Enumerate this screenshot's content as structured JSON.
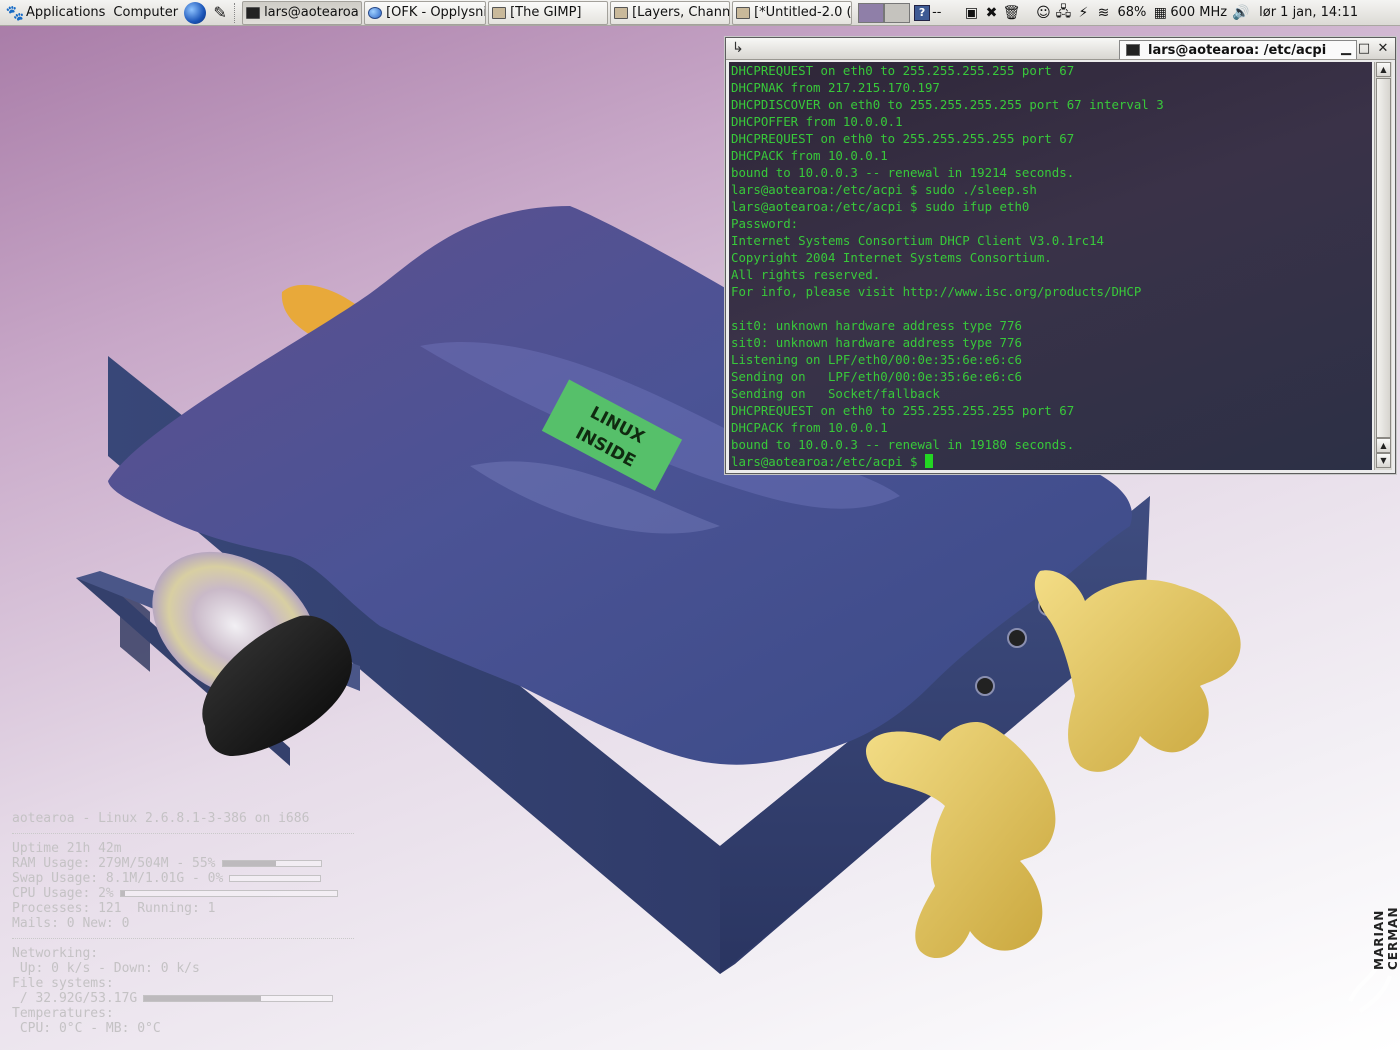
{
  "panel": {
    "applications_label": "Applications",
    "computer_label": "Computer",
    "tasks": [
      {
        "label": "lars@aotearoa",
        "icon": "terminal-icon"
      },
      {
        "label": "[OFK - Opplysni",
        "icon": "web-browser-icon"
      },
      {
        "label": "[The GIMP]",
        "icon": "gimp-icon"
      },
      {
        "label": "[Layers, Chann",
        "icon": "gimp-icon"
      },
      {
        "label": "[*Untitled-2.0 (",
        "icon": "gimp-icon"
      }
    ],
    "help_glyph": "?",
    "help_suffix": "--",
    "battery_label": "68%",
    "cpu_freq_label": "600 MHz",
    "clock_label": "lør  1 jan, 14:11"
  },
  "terminal": {
    "tab_title": "lars@aotearoa: /etc/acpi",
    "menu_glyph": "↳",
    "lines": [
      "DHCPREQUEST on eth0 to 255.255.255.255 port 67",
      "DHCPNAK from 217.215.170.197",
      "DHCPDISCOVER on eth0 to 255.255.255.255 port 67 interval 3",
      "DHCPOFFER from 10.0.0.1",
      "DHCPREQUEST on eth0 to 255.255.255.255 port 67",
      "DHCPACK from 10.0.0.1",
      "bound to 10.0.0.3 -- renewal in 19214 seconds.",
      "lars@aotearoa:/etc/acpi $ sudo ./sleep.sh",
      "lars@aotearoa:/etc/acpi $ sudo ifup eth0",
      "Password:",
      "Internet Systems Consortium DHCP Client V3.0.1rc14",
      "Copyright 2004 Internet Systems Consortium.",
      "All rights reserved.",
      "For info, please visit http://www.isc.org/products/DHCP",
      "",
      "sit0: unknown hardware address type 776",
      "sit0: unknown hardware address type 776",
      "Listening on LPF/eth0/00:0e:35:6e:e6:c6",
      "Sending on   LPF/eth0/00:0e:35:6e:e6:c6",
      "Sending on   Socket/fallback",
      "DHCPREQUEST on eth0 to 255.255.255.255 port 67",
      "DHCPACK from 10.0.0.1",
      "bound to 10.0.0.3 -- renewal in 19180 seconds."
    ],
    "prompt": "lars@aotearoa:/etc/acpi $ "
  },
  "wallpaper": {
    "badge_line1": "LINUX",
    "badge_line2": "INSIDE",
    "signature": "MARIAN CERMAN"
  },
  "sysmon": {
    "header": "aotearoa - Linux 2.6.8.1-3-386 on i686",
    "uptime": "Uptime 21h 42m",
    "ram_label": "RAM Usage: 279M/504M - 55%",
    "ram_fraction": 0.55,
    "swap_label": "Swap Usage: 8.1M/1.01G - 0%",
    "swap_fraction": 0.0,
    "cpu_label": "CPU Usage: 2%",
    "cpu_fraction": 0.02,
    "processes": "Processes: 121  Running: 1",
    "mails": "Mails: 0 New: 0",
    "networking": "Networking:",
    "net_rates": " Up: 0 k/s - Down: 0 k/s",
    "filesystems": "File systems:",
    "fs_label": " / 32.92G/53.17G",
    "fs_fraction": 0.62,
    "temperatures": "Temperatures:",
    "temps": " CPU: 0°C - MB: 0°C"
  }
}
